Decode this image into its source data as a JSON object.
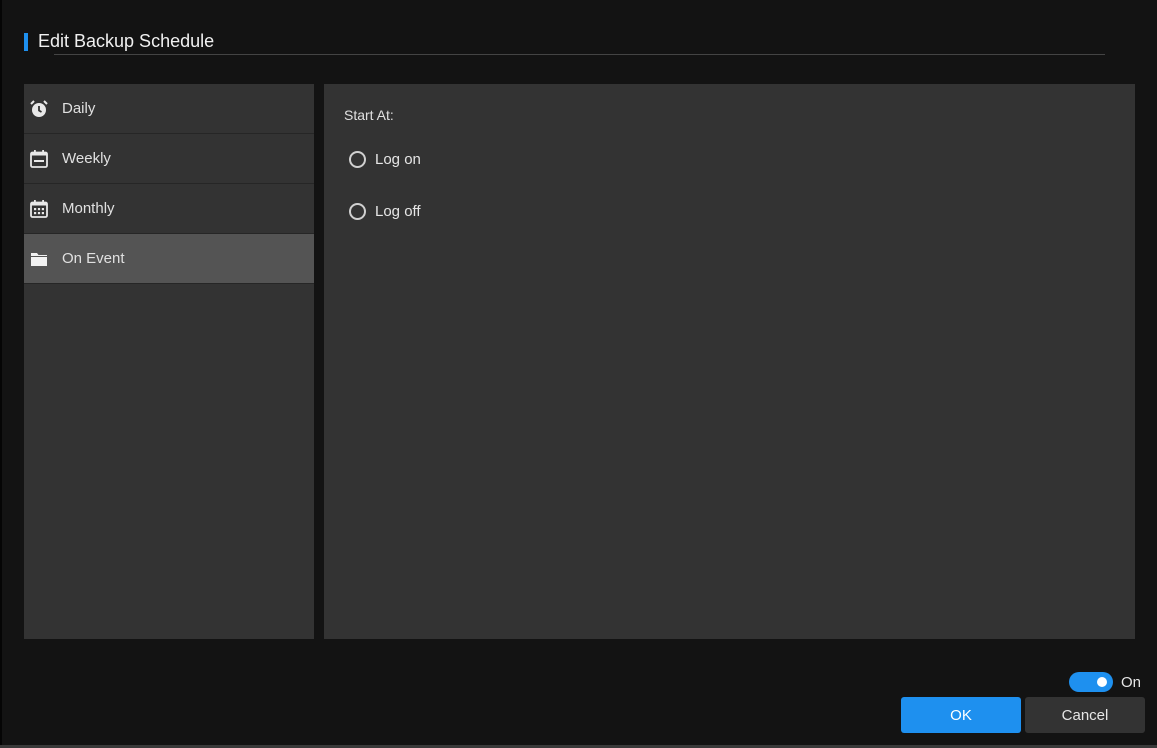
{
  "dialog": {
    "title": "Edit Backup Schedule"
  },
  "sidebar": {
    "items": [
      {
        "label": "Daily",
        "icon": "alarm-clock-icon",
        "active": false
      },
      {
        "label": "Weekly",
        "icon": "calendar-week-icon",
        "active": false
      },
      {
        "label": "Monthly",
        "icon": "calendar-month-icon",
        "active": false
      },
      {
        "label": "On Event",
        "icon": "folder-icon",
        "active": true
      }
    ]
  },
  "main": {
    "start_at_label": "Start At:",
    "options": [
      {
        "label": "Log on",
        "selected": false
      },
      {
        "label": "Log off",
        "selected": false
      }
    ]
  },
  "footer": {
    "toggle_label": "On",
    "toggle_on": true,
    "ok_label": "OK",
    "cancel_label": "Cancel"
  },
  "colors": {
    "accent": "#1e90ef",
    "panel": "#333333",
    "active_item": "#545454",
    "background": "#131313"
  }
}
